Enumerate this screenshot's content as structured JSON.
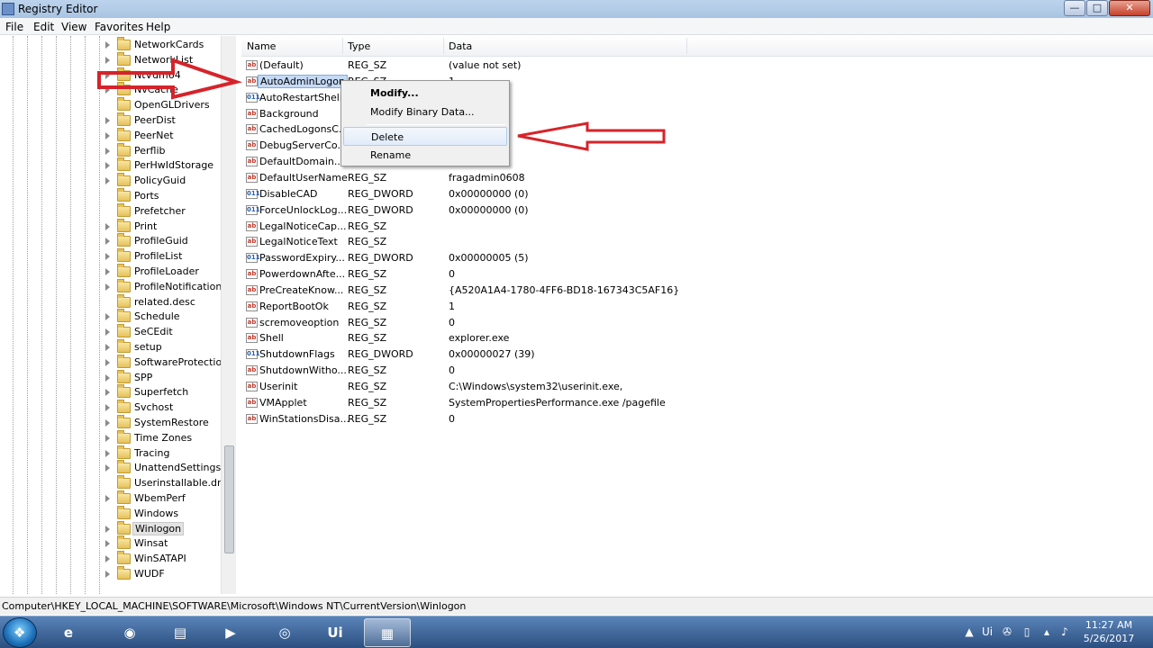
{
  "window": {
    "title": "Registry Editor",
    "controls": {
      "minimize": "—",
      "maximize": "□",
      "close": "✕"
    }
  },
  "menu": [
    "File",
    "Edit",
    "View",
    "Favorites",
    "Help"
  ],
  "tree": {
    "items": [
      {
        "label": "NetworkCards",
        "expandable": true
      },
      {
        "label": "NetworkList",
        "expandable": true
      },
      {
        "label": "NtVdm64",
        "expandable": true
      },
      {
        "label": "NvCache",
        "expandable": true
      },
      {
        "label": "OpenGLDrivers",
        "expandable": false
      },
      {
        "label": "PeerDist",
        "expandable": true
      },
      {
        "label": "PeerNet",
        "expandable": true
      },
      {
        "label": "Perflib",
        "expandable": true
      },
      {
        "label": "PerHwIdStorage",
        "expandable": true
      },
      {
        "label": "PolicyGuid",
        "expandable": true
      },
      {
        "label": "Ports",
        "expandable": false
      },
      {
        "label": "Prefetcher",
        "expandable": false
      },
      {
        "label": "Print",
        "expandable": true
      },
      {
        "label": "ProfileGuid",
        "expandable": true
      },
      {
        "label": "ProfileList",
        "expandable": true
      },
      {
        "label": "ProfileLoader",
        "expandable": true
      },
      {
        "label": "ProfileNotification",
        "expandable": true
      },
      {
        "label": "related.desc",
        "expandable": false
      },
      {
        "label": "Schedule",
        "expandable": true
      },
      {
        "label": "SeCEdit",
        "expandable": true
      },
      {
        "label": "setup",
        "expandable": true
      },
      {
        "label": "SoftwareProtectionPlatform",
        "expandable": true
      },
      {
        "label": "SPP",
        "expandable": true
      },
      {
        "label": "Superfetch",
        "expandable": true
      },
      {
        "label": "Svchost",
        "expandable": true
      },
      {
        "label": "SystemRestore",
        "expandable": true
      },
      {
        "label": "Time Zones",
        "expandable": true
      },
      {
        "label": "Tracing",
        "expandable": true
      },
      {
        "label": "UnattendSettings",
        "expandable": true
      },
      {
        "label": "Userinstallable.drivers",
        "expandable": false
      },
      {
        "label": "WbemPerf",
        "expandable": true
      },
      {
        "label": "Windows",
        "expandable": false
      },
      {
        "label": "Winlogon",
        "expandable": true,
        "selected": true
      },
      {
        "label": "Winsat",
        "expandable": true
      },
      {
        "label": "WinSATAPI",
        "expandable": true
      },
      {
        "label": "WUDF",
        "expandable": true
      }
    ]
  },
  "list": {
    "columns": [
      "Name",
      "Type",
      "Data"
    ],
    "rows": [
      {
        "name": "(Default)",
        "type": "REG_SZ",
        "data": "(value not set)",
        "kind": "sz"
      },
      {
        "name": "AutoAdminLogon",
        "type": "REG_SZ",
        "data": "1",
        "kind": "sz",
        "selected": true
      },
      {
        "name": "AutoRestartShell",
        "type": "",
        "data": "",
        "kind": "bin"
      },
      {
        "name": "Background",
        "type": "",
        "data": "",
        "kind": "sz"
      },
      {
        "name": "CachedLogonsC...",
        "type": "",
        "data": "",
        "kind": "sz"
      },
      {
        "name": "DebugServerCo...",
        "type": "",
        "data": "",
        "kind": "sz"
      },
      {
        "name": "DefaultDomain...",
        "type": "",
        "data": "",
        "kind": "sz"
      },
      {
        "name": "DefaultUserName",
        "type": "REG_SZ",
        "data": "fragadmin0608",
        "kind": "sz"
      },
      {
        "name": "DisableCAD",
        "type": "REG_DWORD",
        "data": "0x00000000 (0)",
        "kind": "bin"
      },
      {
        "name": "ForceUnlockLog...",
        "type": "REG_DWORD",
        "data": "0x00000000 (0)",
        "kind": "bin"
      },
      {
        "name": "LegalNoticeCap...",
        "type": "REG_SZ",
        "data": "",
        "kind": "sz"
      },
      {
        "name": "LegalNoticeText",
        "type": "REG_SZ",
        "data": "",
        "kind": "sz"
      },
      {
        "name": "PasswordExpiry...",
        "type": "REG_DWORD",
        "data": "0x00000005 (5)",
        "kind": "bin"
      },
      {
        "name": "PowerdownAfte...",
        "type": "REG_SZ",
        "data": "0",
        "kind": "sz"
      },
      {
        "name": "PreCreateKnow...",
        "type": "REG_SZ",
        "data": "{A520A1A4-1780-4FF6-BD18-167343C5AF16}",
        "kind": "sz"
      },
      {
        "name": "ReportBootOk",
        "type": "REG_SZ",
        "data": "1",
        "kind": "sz"
      },
      {
        "name": "scremoveoption",
        "type": "REG_SZ",
        "data": "0",
        "kind": "sz"
      },
      {
        "name": "Shell",
        "type": "REG_SZ",
        "data": "explorer.exe",
        "kind": "sz"
      },
      {
        "name": "ShutdownFlags",
        "type": "REG_DWORD",
        "data": "0x00000027 (39)",
        "kind": "bin"
      },
      {
        "name": "ShutdownWitho...",
        "type": "REG_SZ",
        "data": "0",
        "kind": "sz"
      },
      {
        "name": "Userinit",
        "type": "REG_SZ",
        "data": "C:\\Windows\\system32\\userinit.exe,",
        "kind": "sz"
      },
      {
        "name": "VMApplet",
        "type": "REG_SZ",
        "data": "SystemPropertiesPerformance.exe /pagefile",
        "kind": "sz"
      },
      {
        "name": "WinStationsDisa...",
        "type": "REG_SZ",
        "data": "0",
        "kind": "sz"
      }
    ]
  },
  "context_menu": {
    "modify": "Modify...",
    "modify_binary": "Modify Binary Data...",
    "delete": "Delete",
    "rename": "Rename"
  },
  "status_path": "Computer\\HKEY_LOCAL_MACHINE\\SOFTWARE\\Microsoft\\Windows NT\\CurrentVersion\\Winlogon",
  "taskbar": {
    "start_glyph": "❖",
    "apps": [
      {
        "glyph": "e"
      },
      {
        "glyph": "◉"
      },
      {
        "glyph": "▤"
      },
      {
        "glyph": "▶"
      },
      {
        "glyph": "◎"
      },
      {
        "glyph": "Ui"
      },
      {
        "glyph": "▦",
        "active": true
      }
    ],
    "tray": {
      "arrow": "▲",
      "ui": "Ui",
      "net": "✇",
      "battery": "▯",
      "wifi": "▴",
      "volume": "♪"
    },
    "time": "11:27 AM",
    "date": "5/26/2017"
  },
  "colors": {
    "annotation_arrow": "#d6232a",
    "selection": "#c5daf5"
  }
}
